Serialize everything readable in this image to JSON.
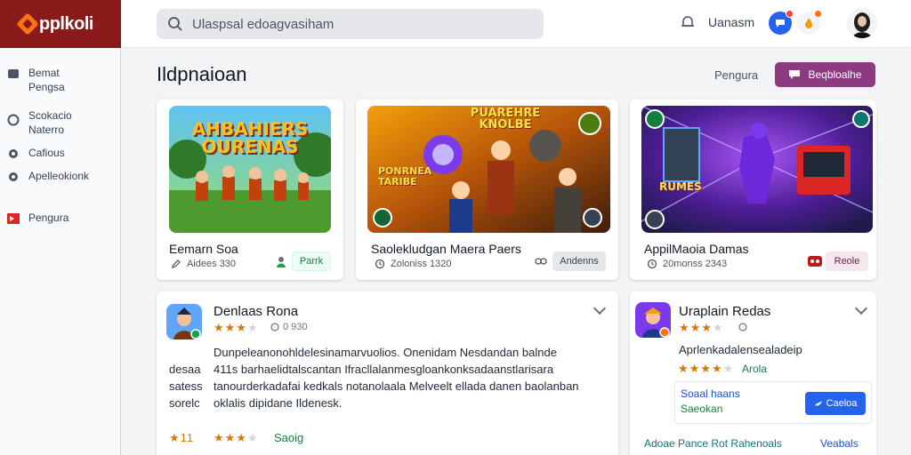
{
  "app": {
    "logo_text": "pplkoli"
  },
  "search": {
    "placeholder": "Ulaspsal edoagvasiham"
  },
  "header": {
    "user_name": "Uanasm"
  },
  "sidebar": {
    "items": [
      {
        "label": "Bemat Pengsa",
        "icon": "briefcase-icon"
      },
      {
        "label": "Scokacio Naterro",
        "icon": "circle-icon"
      },
      {
        "label": "Cafious",
        "icon": "dot-icon"
      },
      {
        "label": "Apelleokionk",
        "icon": "dot-icon"
      },
      {
        "label": "Pengura",
        "icon": "flag-icon"
      }
    ]
  },
  "main": {
    "title": "Ildpnaioan",
    "filter_label": "Pengura",
    "primary_button": "Beqbloalhe"
  },
  "cards": [
    {
      "art_title": "AHBAHIERS OURENAS",
      "title": "Eemarn Soa",
      "meta": "Aidees 330",
      "chip": "Parrk"
    },
    {
      "art_title": "PUAREHRE KNOLBE",
      "art_sub": "PONRNEA TARIBE",
      "title": "Saolekludgan Maera Paers",
      "meta": "Zoloniss 1320",
      "chip": "Andenns"
    },
    {
      "art_title": "RUMES",
      "title": "AppilMaoia Damas",
      "meta": "20monss 2343",
      "chip": "Reole"
    }
  ],
  "reviews": {
    "left": {
      "name": "Denlaas Rona",
      "count": "0 930",
      "rating": 3.5,
      "side_words": [
        "desaa",
        "satess",
        "sorelc"
      ],
      "lines": [
        "Dunpeleanonohldelesinamarvuolios. Onenidam Nesdandan balnde",
        "411s barhaelidtalscantan Ifracllalanmesgloankonksadaanstlarisara",
        "tanourderkadafai kedkals notanolaala Melveelt ellada danen baolanban",
        "oklalis dipidane Ildenesk."
      ],
      "footer_prefix": "★11",
      "footer_rating": 3.5,
      "footer_link": "Saoig"
    },
    "right": {
      "name": "Uraplain Redas",
      "subtitle": "Aprlenkadalensealadeip",
      "rating": 3.5,
      "rating_label": "Arola",
      "box_line1": "Soaal haans",
      "box_line2": "Saeokan",
      "box_button": "Caeloa",
      "footer_left": "Adoae Pance Rot Rahenoals",
      "footer_right": "Veabals"
    }
  },
  "colors": {
    "brand": "#8b1a1a",
    "accent": "#8e3a82",
    "link": "#1d4ed8",
    "star": "#d97706"
  }
}
